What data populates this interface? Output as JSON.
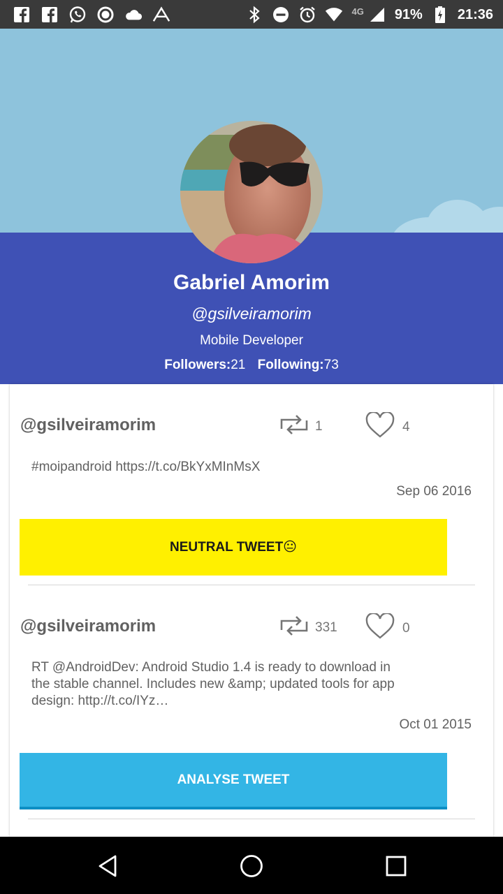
{
  "status_bar": {
    "network": "4G",
    "battery": "91%",
    "time": "21:36",
    "icons_left": [
      "facebook-icon",
      "facebook-icon",
      "whatsapp-icon",
      "circle-icon",
      "cloud-icon",
      "app-icon"
    ],
    "icons_right": [
      "bluetooth-icon",
      "dnd-icon",
      "alarm-icon",
      "wifi-icon",
      "signal-icon",
      "battery-icon"
    ]
  },
  "profile": {
    "name": "Gabriel Amorim",
    "handle": "@gsilveiramorim",
    "bio": "Mobile Developer",
    "followers_label": "Followers:",
    "followers": "21",
    "following_label": "Following:",
    "following": "73"
  },
  "tweets": [
    {
      "handle": "@gsilveiramorim",
      "retweets": "1",
      "likes": "4",
      "text": "#moipandroid https://t.co/BkYxMInMsX",
      "date": "Sep 06 2016",
      "button_label": "NEUTRAL TWEET😐"
    },
    {
      "handle": "@gsilveiramorim",
      "retweets": "331",
      "likes": "0",
      "text": "RT @AndroidDev: Android Studio 1.4 is ready to download in the stable channel. Includes new &amp; updated tools for app design: http://t.co/IYz…",
      "date": "Oct 01 2015",
      "button_label": "ANALYSE TWEET"
    }
  ],
  "colors": {
    "banner": "#8ec3dc",
    "profile_band": "#3f51b5",
    "neutral_button": "#fff000",
    "analyse_button": "#33b5e5",
    "status_bar": "#3a3a3a",
    "nav_bar": "#000000"
  }
}
